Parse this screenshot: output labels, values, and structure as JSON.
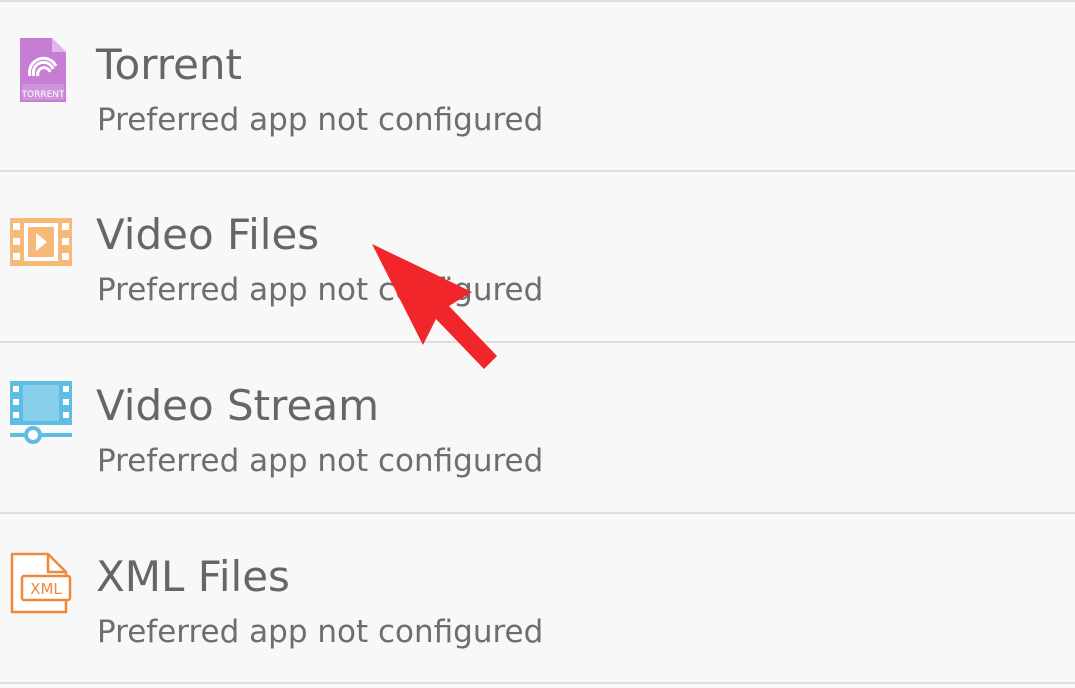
{
  "file_types": [
    {
      "title": "Torrent",
      "subtitle": "Preferred app not configured",
      "icon": "torrent-file-icon",
      "icon_label": "TORRENT",
      "icon_color": "#c57ed3"
    },
    {
      "title": "Video Files",
      "subtitle": "Preferred app not configured",
      "icon": "video-film-icon",
      "icon_color": "#f6b978"
    },
    {
      "title": "Video Stream",
      "subtitle": "Preferred app not configured",
      "icon": "video-stream-icon",
      "icon_color": "#5ebde2"
    },
    {
      "title": "XML Files",
      "subtitle": "Preferred app not configured",
      "icon": "xml-file-icon",
      "icon_label": "XML",
      "icon_color": "#f0883a"
    }
  ],
  "annotation": {
    "icon": "pointer-arrow-icon",
    "color": "#f0262b"
  }
}
